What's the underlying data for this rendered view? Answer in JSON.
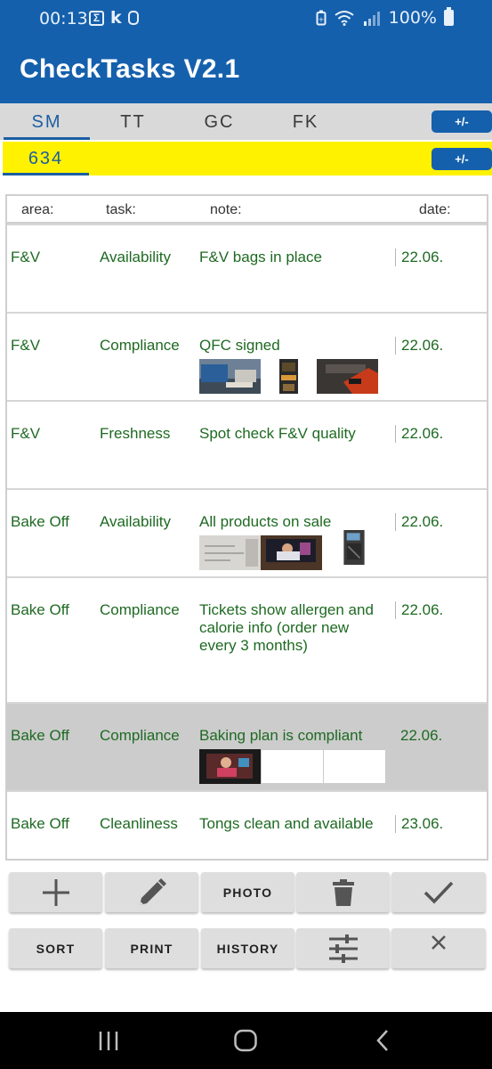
{
  "status_bar": {
    "time": "00:13",
    "battery": "100%",
    "icons": [
      "sigma-box-icon",
      "k-icon",
      "watch-icon",
      "battery-saver-icon",
      "wifi-call-icon",
      "signal-icon",
      "battery-icon"
    ]
  },
  "app": {
    "title": "CheckTasks V2.1"
  },
  "tabs": [
    {
      "label": "SM",
      "active": true
    },
    {
      "label": "TT",
      "active": false
    },
    {
      "label": "GC",
      "active": false
    },
    {
      "label": "FK",
      "active": false
    }
  ],
  "tabs_toggle_label": "+/-",
  "store": {
    "number": "634",
    "toggle_label": "+/-"
  },
  "table": {
    "headers": {
      "area": "area:",
      "task": "task:",
      "note": "note:",
      "date": "date:"
    },
    "rows": [
      {
        "area": "F&V",
        "task": "Availability",
        "note": "F&V bags in place",
        "date": "22.06.",
        "photos": 0,
        "selected": false
      },
      {
        "area": "F&V",
        "task": "Compliance",
        "note": "QFC signed",
        "date": "22.06.",
        "photos": 3,
        "selected": false
      },
      {
        "area": "F&V",
        "task": "Freshness",
        "note": "Spot check F&V quality",
        "date": "22.06.",
        "photos": 0,
        "selected": false
      },
      {
        "area": "Bake Off",
        "task": "Availability",
        "note": "All products on sale",
        "date": "22.06.",
        "photos": 3,
        "selected": false
      },
      {
        "area": "Bake Off",
        "task": "Compliance",
        "note": "Tickets show allergen and calorie info (order new every 3 months)",
        "date": "22.06.",
        "photos": 0,
        "selected": false
      },
      {
        "area": "Bake Off",
        "task": "Compliance",
        "note": "Baking plan is compliant",
        "date": "22.06.",
        "photos": 3,
        "selected": true
      },
      {
        "area": "Bake Off",
        "task": "Cleanliness",
        "note": "Tongs clean and available",
        "date": "23.06.",
        "photos": 0,
        "selected": false
      }
    ]
  },
  "toolbar": {
    "add_icon": "plus-icon",
    "edit_icon": "pencil-icon",
    "photo_label": "PHOTO",
    "delete_icon": "trash-icon",
    "done_icon": "checkmark-icon",
    "sort_label": "SORT",
    "print_label": "PRINT",
    "history_label": "HISTORY",
    "filter_icon": "sliders-icon",
    "clear_icon": "close-icon"
  },
  "nav": {
    "icons": [
      "recent-apps-icon",
      "home-icon",
      "back-icon"
    ]
  },
  "colors": {
    "primary": "#1560ac",
    "highlight": "#fff200",
    "row_text": "#1e6a22",
    "selected_row": "#cccccc"
  }
}
